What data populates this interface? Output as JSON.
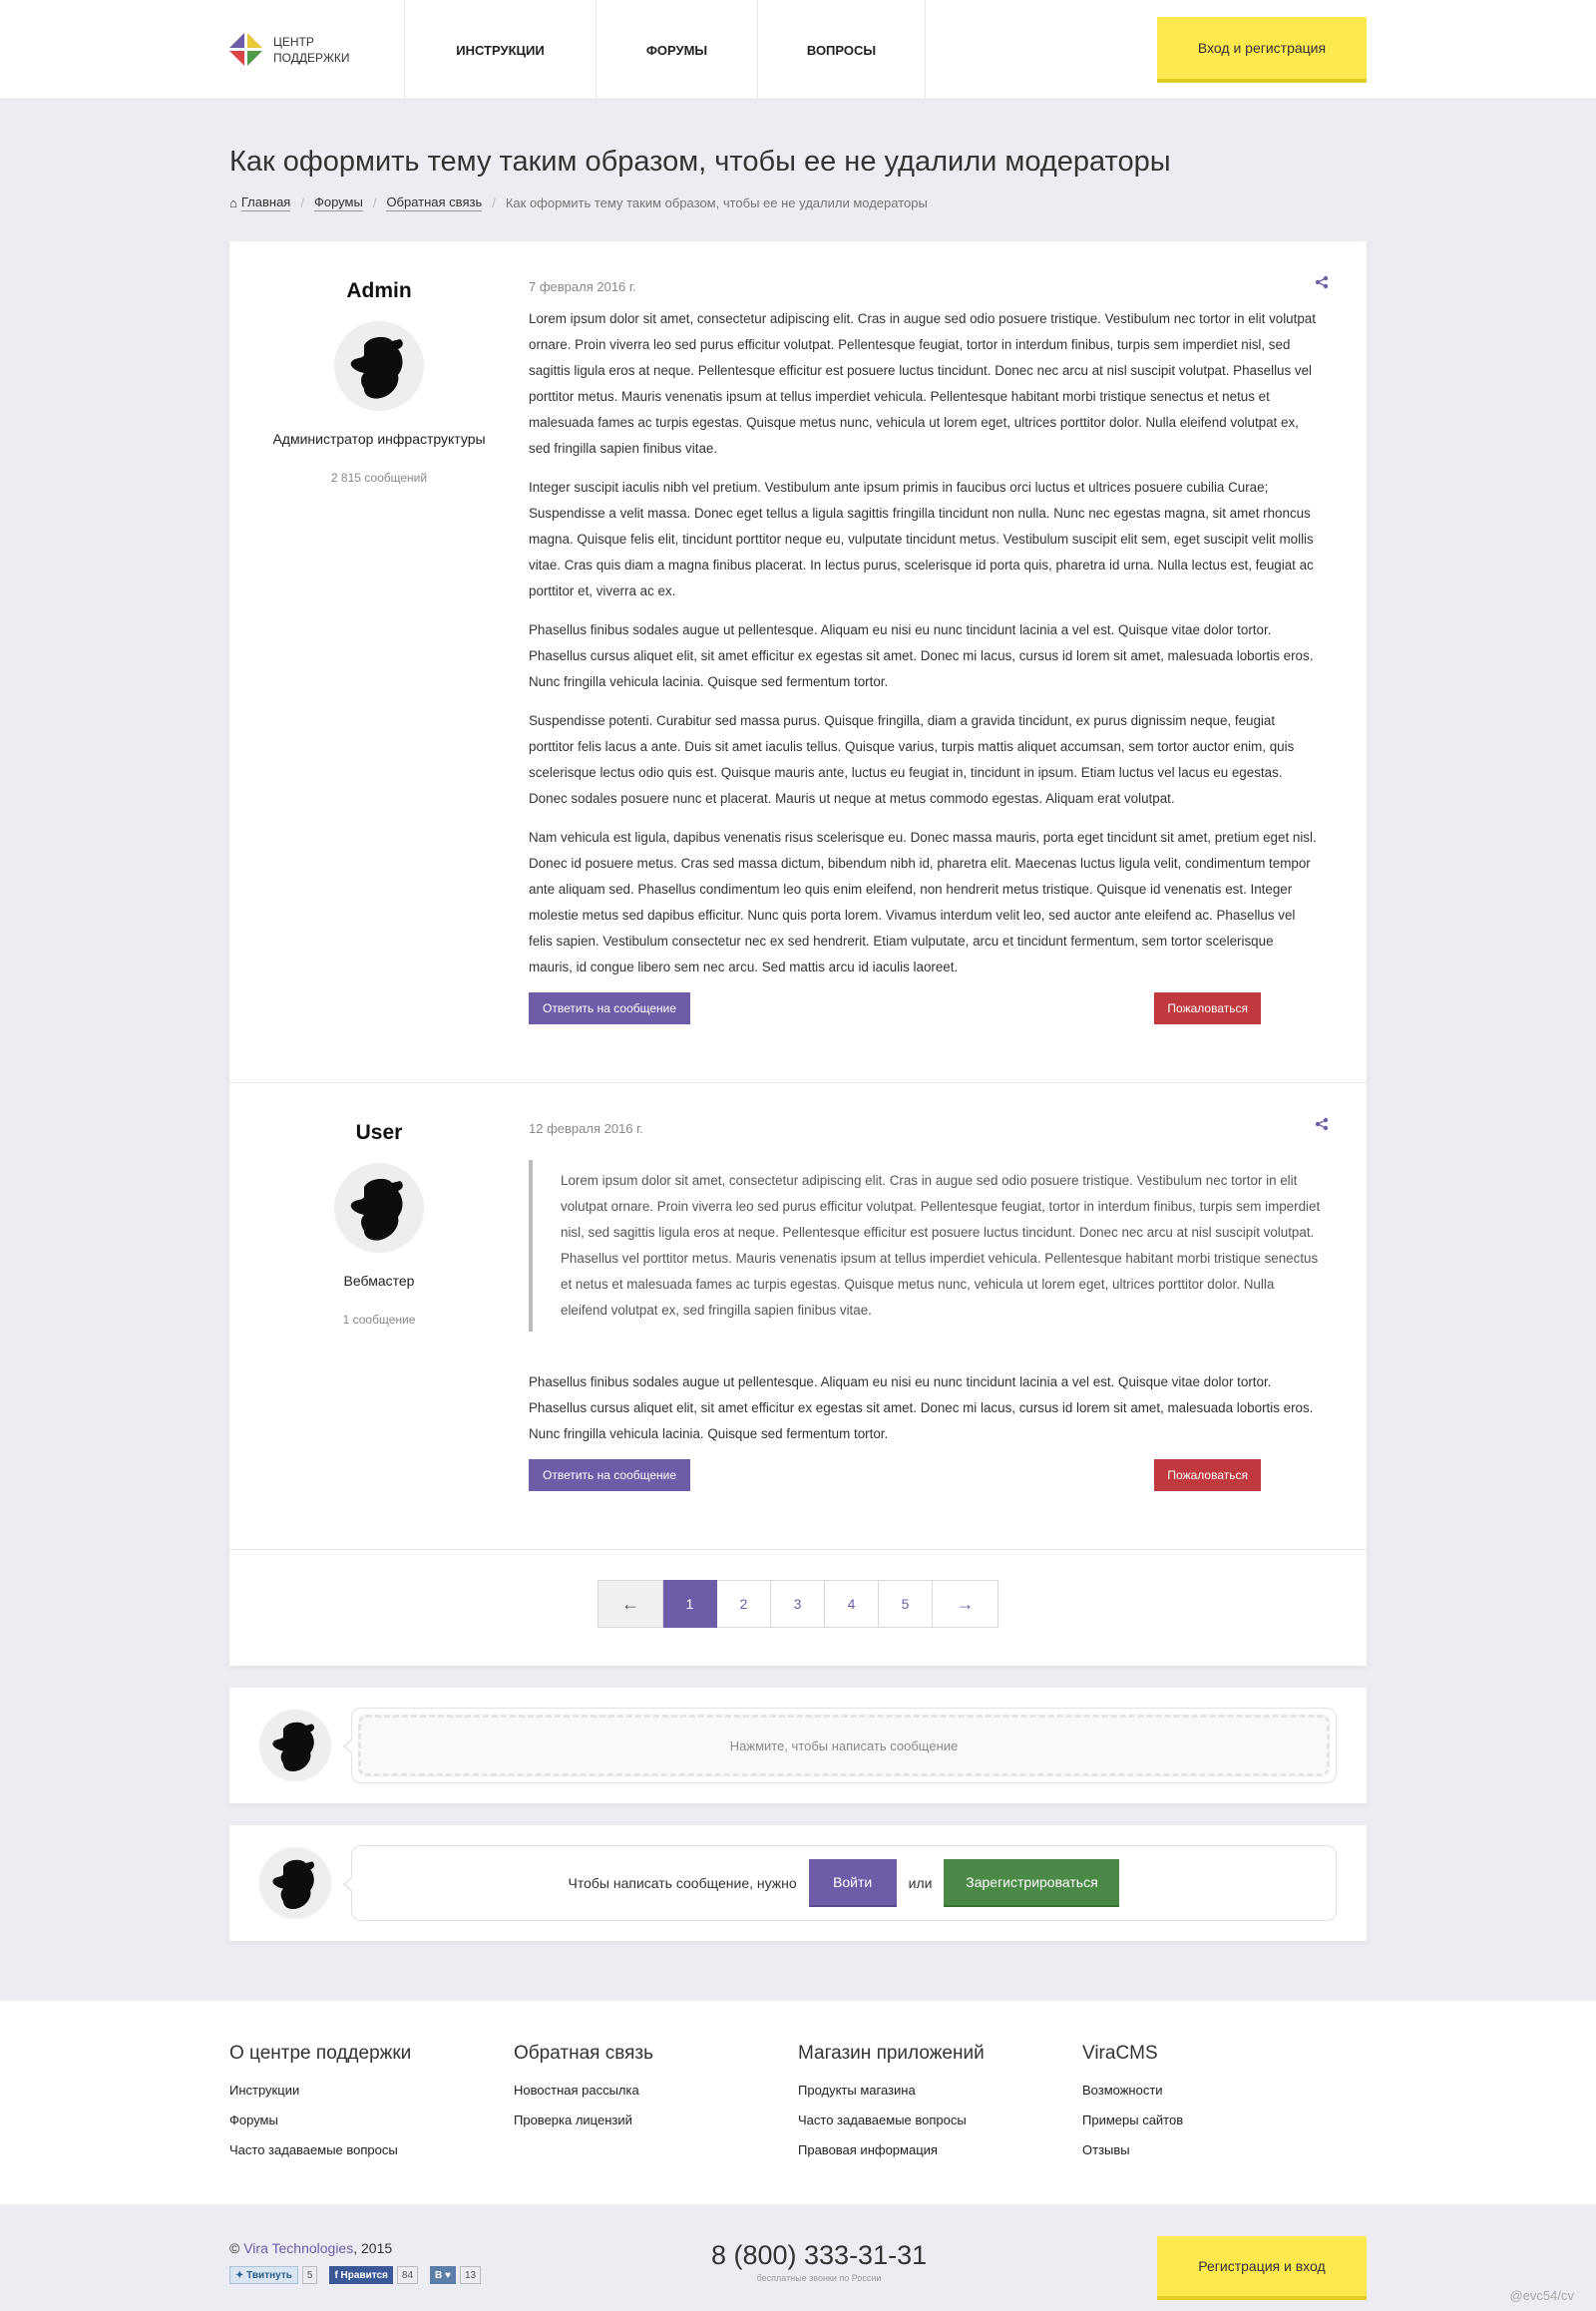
{
  "header": {
    "logo_line1": "Центр",
    "logo_line2": "поддержки",
    "nav": [
      "Инструкции",
      "Форумы",
      "Вопросы"
    ],
    "login_label": "Вход и регистрация"
  },
  "page": {
    "title": "Как оформить тему таким образом, чтобы ее не удалили модераторы",
    "breadcrumb": [
      "Главная",
      "Форумы",
      "Обратная связь",
      "Как оформить тему таким образом, чтобы ее не удалили модераторы"
    ]
  },
  "posts": [
    {
      "author": "Admin",
      "role": "Администратор инфраструктуры",
      "count": "2 815 сообщений",
      "date": "7 февраля 2016 г.",
      "paragraphs": [
        "Lorem ipsum dolor sit amet, consectetur adipiscing elit. Cras in augue sed odio posuere tristique. Vestibulum nec tortor in elit volutpat ornare. Proin viverra leo sed purus efficitur volutpat. Pellentesque feugiat, tortor in interdum finibus, turpis sem imperdiet nisl, sed sagittis ligula eros at neque. Pellentesque efficitur est posuere luctus tincidunt. Donec nec arcu at nisl suscipit volutpat. Phasellus vel porttitor metus. Mauris venenatis ipsum at tellus imperdiet vehicula. Pellentesque habitant morbi tristique senectus et netus et malesuada fames ac turpis egestas. Quisque metus nunc, vehicula ut lorem eget, ultrices porttitor dolor. Nulla eleifend volutpat ex, sed fringilla sapien finibus vitae.",
        "Integer suscipit iaculis nibh vel pretium. Vestibulum ante ipsum primis in faucibus orci luctus et ultrices posuere cubilia Curae; Suspendisse a velit massa. Donec eget tellus a ligula sagittis fringilla tincidunt non nulla. Nunc nec egestas magna, sit amet rhoncus magna. Quisque felis elit, tincidunt porttitor neque eu, vulputate tincidunt metus. Vestibulum suscipit elit sem, eget suscipit velit mollis vitae. Cras quis diam a magna finibus placerat. In lectus purus, scelerisque id porta quis, pharetra id urna. Nulla lectus est, feugiat ac porttitor et, viverra ac ex.",
        "Phasellus finibus sodales augue ut pellentesque. Aliquam eu nisi eu nunc tincidunt lacinia a vel est. Quisque vitae dolor tortor. Phasellus cursus aliquet elit, sit amet efficitur ex egestas sit amet. Donec mi lacus, cursus id lorem sit amet, malesuada lobortis eros. Nunc fringilla vehicula lacinia. Quisque sed fermentum tortor.",
        "Suspendisse potenti. Curabitur sed massa purus. Quisque fringilla, diam a gravida tincidunt, ex purus dignissim neque, feugiat porttitor felis lacus a ante. Duis sit amet iaculis tellus. Quisque varius, turpis mattis aliquet accumsan, sem tortor auctor enim, quis scelerisque lectus odio quis est. Quisque mauris ante, luctus eu feugiat in, tincidunt in ipsum. Etiam luctus vel lacus eu egestas. Donec sodales posuere nunc et placerat. Mauris ut neque at metus commodo egestas. Aliquam erat volutpat.",
        "Nam vehicula est ligula, dapibus venenatis risus scelerisque eu. Donec massa mauris, porta eget tincidunt sit amet, pretium eget nisl. Donec id posuere metus. Cras sed massa dictum, bibendum nibh id, pharetra elit. Maecenas luctus ligula velit, condimentum tempor ante aliquam sed. Phasellus condimentum leo quis enim eleifend, non hendrerit metus tristique. Quisque id venenatis est. Integer molestie metus sed dapibus efficitur. Nunc quis porta lorem. Vivamus interdum velit leo, sed auctor ante eleifend ac. Phasellus vel felis sapien. Vestibulum consectetur nec ex sed hendrerit. Etiam vulputate, arcu et tincidunt fermentum, sem tortor scelerisque mauris, id congue libero sem nec arcu. Sed mattis arcu id iaculis laoreet."
      ],
      "reply_label": "Ответить на сообщение",
      "report_label": "Пожаловаться"
    },
    {
      "author": "User",
      "role": "Вебмастер",
      "count": "1 сообщение",
      "date": "12 февраля 2016 г.",
      "quote": "Lorem ipsum dolor sit amet, consectetur adipiscing elit. Cras in augue sed odio posuere tristique. Vestibulum nec tortor in elit volutpat ornare. Proin viverra leo sed purus efficitur volutpat. Pellentesque feugiat, tortor in interdum finibus, turpis sem imperdiet nisl, sed sagittis ligula eros at neque. Pellentesque efficitur est posuere luctus tincidunt. Donec nec arcu at nisl suscipit volutpat. Phasellus vel porttitor metus. Mauris venenatis ipsum at tellus imperdiet vehicula. Pellentesque habitant morbi tristique senectus et netus et malesuada fames ac turpis egestas. Quisque metus nunc, vehicula ut lorem eget, ultrices porttitor dolor. Nulla eleifend volutpat ex, sed fringilla sapien finibus vitae.",
      "paragraphs": [
        "Phasellus finibus sodales augue ut pellentesque. Aliquam eu nisi eu nunc tincidunt lacinia a vel est. Quisque vitae dolor tortor. Phasellus cursus aliquet elit, sit amet efficitur ex egestas sit amet. Donec mi lacus, cursus id lorem sit amet, malesuada lobortis eros. Nunc fringilla vehicula lacinia. Quisque sed fermentum tortor."
      ],
      "reply_label": "Ответить на сообщение",
      "report_label": "Пожаловаться"
    }
  ],
  "pagination": {
    "prev": "←",
    "pages": [
      "1",
      "2",
      "3",
      "4",
      "5"
    ],
    "next": "→",
    "current": "1"
  },
  "compose": {
    "placeholder": "Нажмите, чтобы написать сообщение"
  },
  "login_prompt": {
    "text": "Чтобы написать сообщение, нужно",
    "login": "Войти",
    "or": "или",
    "register": "Зарегистрироваться"
  },
  "footer": {
    "columns": [
      {
        "title": "О центре поддержки",
        "links": [
          "Инструкции",
          "Форумы",
          "Часто задаваемые вопросы"
        ]
      },
      {
        "title": "Обратная связь",
        "links": [
          "Новостная рассылка",
          "Проверка лицензий"
        ]
      },
      {
        "title": "Магазин приложений",
        "links": [
          "Продукты магазина",
          "Часто задаваемые вопросы",
          "Правовая информация"
        ]
      },
      {
        "title": "ViraCMS",
        "links": [
          "Возможности",
          "Примеры сайтов",
          "Отзывы"
        ]
      }
    ],
    "copyright_prefix": "©",
    "brand": "Vira Technologies",
    "year": ", 2015",
    "socials": [
      {
        "label": "Твитнуть",
        "count": "5"
      },
      {
        "label": "Нравится",
        "count": "84"
      },
      {
        "label": "В",
        "count": "13"
      }
    ],
    "phone": "8 (800) 333-31-31",
    "phone_note": "бесплатные звонки по России",
    "register_label": "Регистрация и вход",
    "credit": "@evc54/cv"
  },
  "colors": {
    "accent": "#6f5ca8",
    "yellow": "#fbe94f",
    "danger": "#c0393e",
    "success": "#4a8a46"
  }
}
